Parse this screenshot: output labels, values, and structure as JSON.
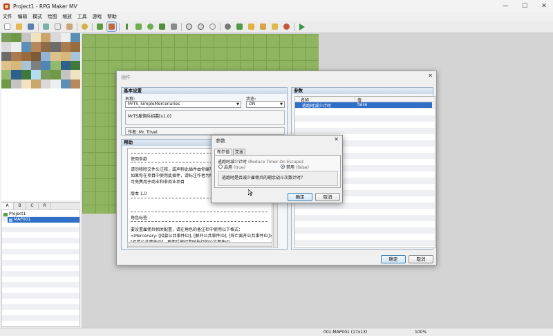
{
  "app": {
    "title": "Project1 - RPG Maker MV",
    "minimize": "—",
    "maximize": "☐",
    "close": "✕"
  },
  "menubar": [
    "文件",
    "编辑",
    "模式",
    "绘图",
    "缩放",
    "工具",
    "游戏",
    "帮助"
  ],
  "tileset_tabs": [
    "A",
    "B",
    "C",
    "R"
  ],
  "tree": {
    "project": "Project1",
    "map": "MAP001"
  },
  "statusbar": {
    "map_info": "001:MAP001 (17x13)",
    "zoom": "100%"
  },
  "plugin_dialog": {
    "title": "插件",
    "close": "✕",
    "basic_settings": "基本设置",
    "name_label": "名称:",
    "name_value": "MrTS_SimpleMercenaries",
    "status_label": "状态:",
    "status_value": "ON",
    "description": "MrTS雇佣兵招募[v1.0]",
    "author": "作者: Mr. Trivel",
    "help_title": "帮助",
    "help_lines": {
      "terms_title": "使用条款",
      "terms_1": "请勿移除文件头注释，或声称此插件由你编写",
      "terms_2": "如果你在项目中使用此插件，请标注作者为Mr. Trivel",
      "terms_3": "可免费用于商业和非商业项目",
      "version": "版本 1.0",
      "actor_tags": "角色标签",
      "actor_desc": "要设置雇佣兵相关配置，请在角色的备注栏中使用以下格式：",
      "tag_1": "<Mercenary: [招募公共事件ID], [解开公共事件ID], [阵亡离开公共事件ID]>",
      "tag_2": "[招募公共事件ID] - 雇佣兵被招募时执行的公共事件ID"
    },
    "params_title": "参数",
    "col_name": "名称",
    "col_value": "值",
    "param_row_name": "逃跑时减少计时",
    "param_row_value": "false",
    "ok": "确定",
    "cancel": "取消"
  },
  "params_dialog": {
    "title": "参数",
    "close": "✕",
    "tab_boolean": "布尔值",
    "tab_text": "文本",
    "field_label": "逃跑时减少计时",
    "field_label_en": "(Reduce Timer On Escape):",
    "option_on": "启用",
    "option_on_en": "(true)",
    "option_off": "禁用",
    "option_off_en": "(false)",
    "description": "逃跑时是否减少雇佣兵的剩余战斗次数计时？",
    "ok": "确定",
    "cancel": "取消"
  }
}
